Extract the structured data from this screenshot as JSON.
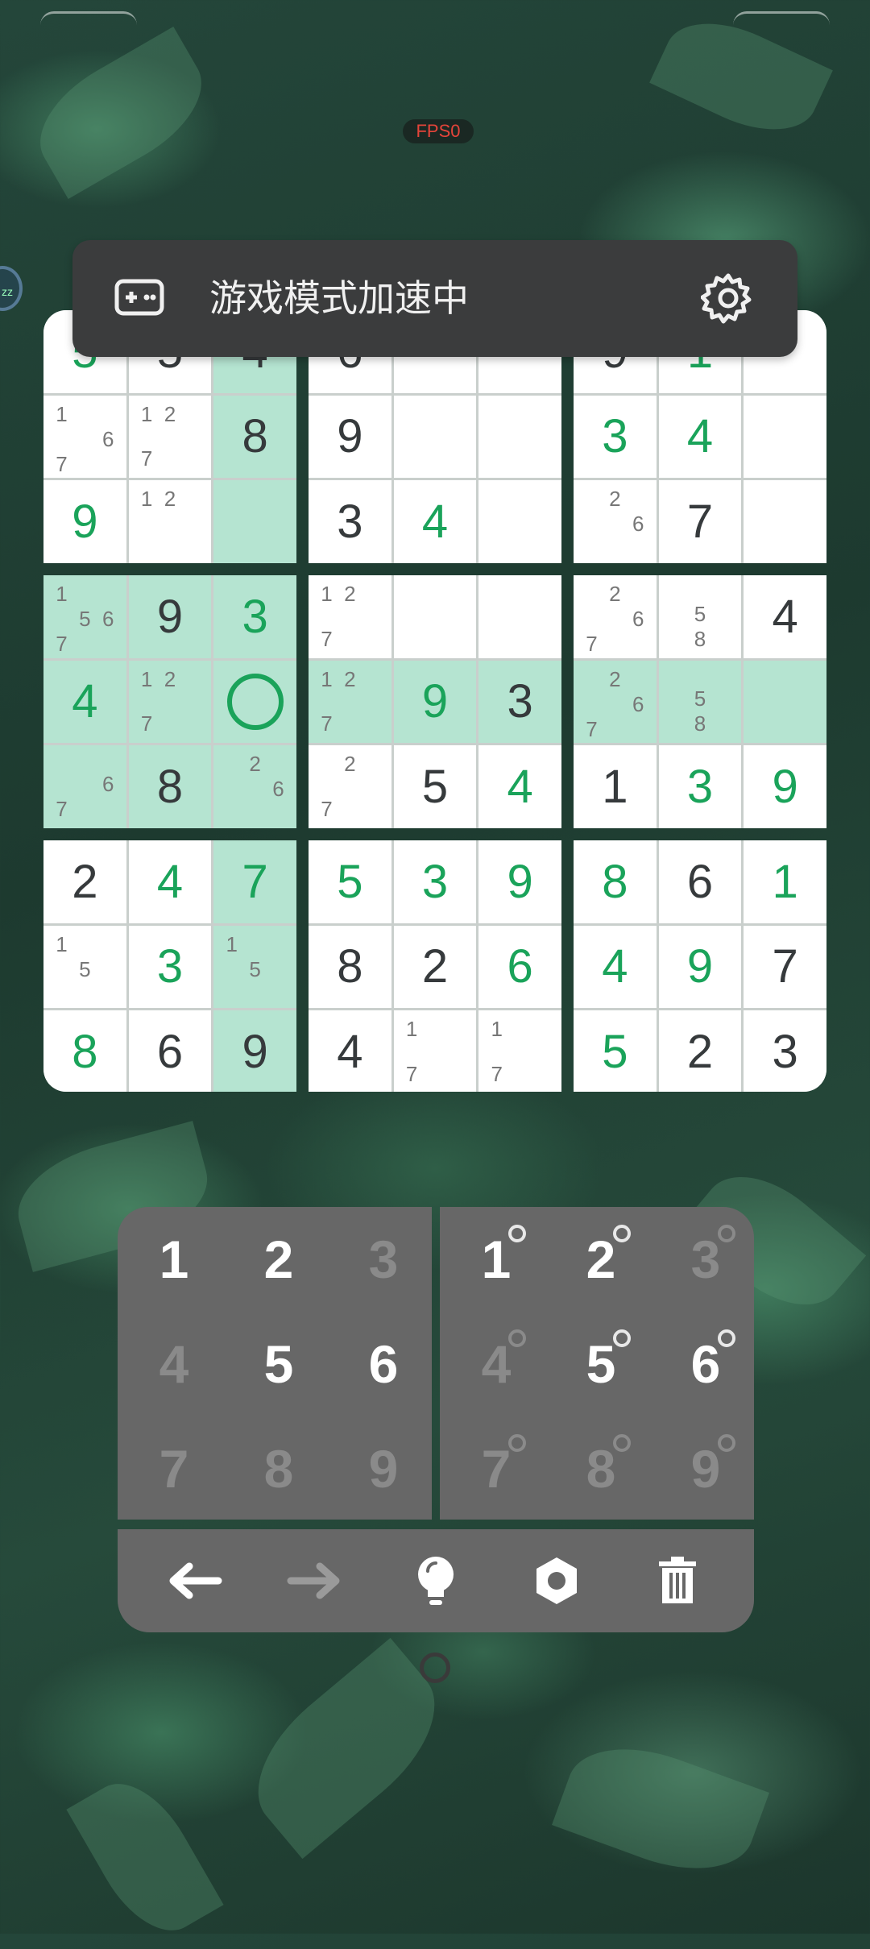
{
  "status": {
    "fps_label": "FPS0",
    "side_bubble_text": "zz"
  },
  "banner": {
    "title": "游戏模式加速中",
    "left_icon": "gamepad-icon",
    "right_icon": "gear-icon"
  },
  "board": {
    "cells": [
      [
        {
          "v": "5",
          "t": "user"
        },
        {
          "v": "5",
          "t": "given"
        },
        {
          "v": "4",
          "t": "given",
          "hl": true
        },
        {
          "v": "6",
          "t": "given"
        },
        {
          "v": ""
        },
        {
          "v": ""
        },
        {
          "v": "9",
          "t": "given"
        },
        {
          "v": "1",
          "t": "user"
        },
        {
          "v": ""
        }
      ],
      [
        {
          "n": [
            "1",
            "",
            "",
            "",
            "",
            "6",
            "7",
            "",
            ""
          ]
        },
        {
          "n": [
            "1",
            "2",
            "",
            "",
            "",
            "",
            "7",
            "",
            ""
          ]
        },
        {
          "v": "8",
          "t": "given",
          "hl": true
        },
        {
          "v": "9",
          "t": "given"
        },
        {
          "v": ""
        },
        {
          "v": ""
        },
        {
          "v": "3",
          "t": "user"
        },
        {
          "v": "4",
          "t": "user"
        },
        {
          "v": ""
        }
      ],
      [
        {
          "v": "9",
          "t": "user"
        },
        {
          "n": [
            "1",
            "2",
            "",
            "",
            "",
            "",
            "",
            "",
            ""
          ]
        },
        {
          "v": "",
          "hl": true
        },
        {
          "v": "3",
          "t": "given"
        },
        {
          "v": "4",
          "t": "user"
        },
        {
          "v": ""
        },
        {
          "n": [
            "",
            "2",
            "",
            "",
            "",
            "6",
            "",
            "",
            ""
          ]
        },
        {
          "v": "7",
          "t": "given"
        },
        {
          "v": ""
        }
      ],
      [
        {
          "n": [
            "1",
            "",
            "",
            "",
            "5",
            "6",
            "7",
            "",
            ""
          ],
          "hl": true
        },
        {
          "v": "9",
          "t": "given",
          "hl": true
        },
        {
          "v": "3",
          "t": "user",
          "hl": true
        },
        {
          "n": [
            "1",
            "2",
            "",
            "",
            "",
            "",
            "7",
            "",
            ""
          ]
        },
        {
          "v": ""
        },
        {
          "v": ""
        },
        {
          "n": [
            "",
            "2",
            "",
            "",
            "",
            "6",
            "7",
            "",
            ""
          ]
        },
        {
          "n": [
            "",
            "",
            "",
            "",
            "5",
            "",
            "",
            "8",
            ""
          ]
        },
        {
          "v": "4",
          "t": "given"
        }
      ],
      [
        {
          "v": "4",
          "t": "user",
          "hl": true
        },
        {
          "n": [
            "1",
            "2",
            "",
            "",
            "",
            "",
            "7",
            "",
            ""
          ],
          "hl": true
        },
        {
          "v": "",
          "ring": true,
          "hl": true
        },
        {
          "n": [
            "1",
            "2",
            "",
            "",
            "",
            "",
            "7",
            "",
            ""
          ],
          "hl": true
        },
        {
          "v": "9",
          "t": "user",
          "hl": true
        },
        {
          "v": "3",
          "t": "given",
          "hl": true
        },
        {
          "n": [
            "",
            "2",
            "",
            "",
            "",
            "6",
            "7",
            "",
            ""
          ],
          "hl": true
        },
        {
          "n": [
            "",
            "",
            "",
            "",
            "5",
            "",
            "",
            "8",
            ""
          ],
          "hl": true
        },
        {
          "v": "",
          "hl": true
        }
      ],
      [
        {
          "n": [
            "",
            "",
            "",
            "",
            "",
            "6",
            "7",
            "",
            ""
          ],
          "hl": true
        },
        {
          "v": "8",
          "t": "given",
          "hl": true
        },
        {
          "n": [
            "",
            "2",
            "",
            "",
            "",
            "6",
            "",
            "",
            ""
          ],
          "hl": true
        },
        {
          "n": [
            "",
            "2",
            "",
            "",
            "",
            "",
            "7",
            "",
            ""
          ]
        },
        {
          "v": "5",
          "t": "given"
        },
        {
          "v": "4",
          "t": "user"
        },
        {
          "v": "1",
          "t": "given"
        },
        {
          "v": "3",
          "t": "user"
        },
        {
          "v": "9",
          "t": "user"
        }
      ],
      [
        {
          "v": "2",
          "t": "given"
        },
        {
          "v": "4",
          "t": "user"
        },
        {
          "v": "7",
          "t": "user",
          "hl": true
        },
        {
          "v": "5",
          "t": "user"
        },
        {
          "v": "3",
          "t": "user"
        },
        {
          "v": "9",
          "t": "user"
        },
        {
          "v": "8",
          "t": "user"
        },
        {
          "v": "6",
          "t": "given"
        },
        {
          "v": "1",
          "t": "user"
        }
      ],
      [
        {
          "n": [
            "1",
            "",
            "",
            "",
            "5",
            "",
            "",
            "",
            ""
          ]
        },
        {
          "v": "3",
          "t": "user"
        },
        {
          "n": [
            "1",
            "",
            "",
            "",
            "5",
            "",
            "",
            "",
            ""
          ],
          "hl": true
        },
        {
          "v": "8",
          "t": "given"
        },
        {
          "v": "2",
          "t": "given"
        },
        {
          "v": "6",
          "t": "user"
        },
        {
          "v": "4",
          "t": "user"
        },
        {
          "v": "9",
          "t": "user"
        },
        {
          "v": "7",
          "t": "given"
        }
      ],
      [
        {
          "v": "8",
          "t": "user"
        },
        {
          "v": "6",
          "t": "given"
        },
        {
          "v": "9",
          "t": "given",
          "hl": true
        },
        {
          "v": "4",
          "t": "given"
        },
        {
          "n": [
            "1",
            "",
            "",
            "",
            "",
            "",
            "7",
            "",
            ""
          ]
        },
        {
          "n": [
            "1",
            "",
            "",
            "",
            "",
            "",
            "7",
            "",
            ""
          ]
        },
        {
          "v": "5",
          "t": "user"
        },
        {
          "v": "2",
          "t": "given"
        },
        {
          "v": "3",
          "t": "given"
        }
      ]
    ]
  },
  "number_pad": {
    "keys": [
      {
        "label": "1",
        "enabled": true
      },
      {
        "label": "2",
        "enabled": true
      },
      {
        "label": "3",
        "enabled": false
      },
      {
        "label": "4",
        "enabled": false
      },
      {
        "label": "5",
        "enabled": true
      },
      {
        "label": "6",
        "enabled": true
      },
      {
        "label": "7",
        "enabled": false
      },
      {
        "label": "8",
        "enabled": false
      },
      {
        "label": "9",
        "enabled": false
      }
    ]
  },
  "notes_pad": {
    "keys": [
      {
        "label": "1",
        "enabled": true
      },
      {
        "label": "2",
        "enabled": true
      },
      {
        "label": "3",
        "enabled": false
      },
      {
        "label": "4",
        "enabled": false
      },
      {
        "label": "5",
        "enabled": true
      },
      {
        "label": "6",
        "enabled": true
      },
      {
        "label": "7",
        "enabled": false
      },
      {
        "label": "8",
        "enabled": false
      },
      {
        "label": "9",
        "enabled": false
      }
    ]
  },
  "toolbar": {
    "tools": [
      {
        "name": "undo-arrow-icon",
        "enabled": true
      },
      {
        "name": "redo-arrow-icon",
        "enabled": false
      },
      {
        "name": "hint-bulb-icon",
        "enabled": true
      },
      {
        "name": "settings-gear-icon",
        "enabled": true
      },
      {
        "name": "delete-trash-icon",
        "enabled": true
      }
    ]
  },
  "colors": {
    "highlight": "#b5e4d1",
    "user_digit": "#1aa35a",
    "given_digit": "#363a3c",
    "pad": "#676767",
    "banner": "#3b3c3d"
  }
}
